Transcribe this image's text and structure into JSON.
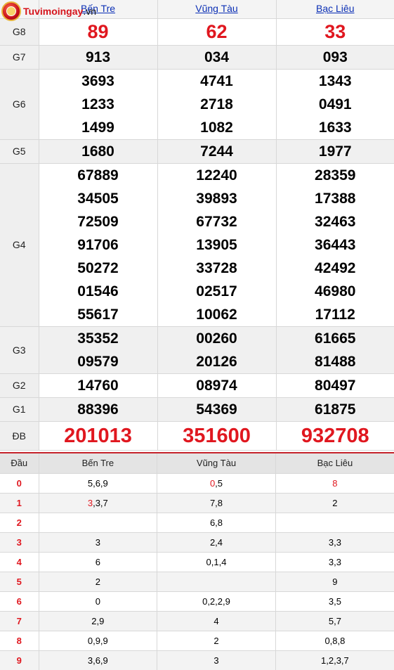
{
  "logo": {
    "name_main": "Tuvimoingay",
    "name_tld": ".vn"
  },
  "provinces": [
    "Bến Tre",
    "Vũng Tàu",
    "Bạc Liêu"
  ],
  "prizes": [
    {
      "label": "G8",
      "values": [
        [
          "89"
        ],
        [
          "62"
        ],
        [
          "33"
        ]
      ]
    },
    {
      "label": "G7",
      "values": [
        [
          "913"
        ],
        [
          "034"
        ],
        [
          "093"
        ]
      ]
    },
    {
      "label": "G6",
      "values": [
        [
          "3693",
          "1233",
          "1499"
        ],
        [
          "4741",
          "2718",
          "1082"
        ],
        [
          "1343",
          "0491",
          "1633"
        ]
      ]
    },
    {
      "label": "G5",
      "values": [
        [
          "1680"
        ],
        [
          "7244"
        ],
        [
          "1977"
        ]
      ]
    },
    {
      "label": "G4",
      "values": [
        [
          "67889",
          "34505",
          "72509",
          "91706",
          "50272",
          "01546",
          "55617"
        ],
        [
          "12240",
          "39893",
          "67732",
          "13905",
          "33728",
          "02517",
          "10062"
        ],
        [
          "28359",
          "17388",
          "32463",
          "36443",
          "42492",
          "46980",
          "17112"
        ]
      ]
    },
    {
      "label": "G3",
      "values": [
        [
          "35352",
          "09579"
        ],
        [
          "00260",
          "20126"
        ],
        [
          "61665",
          "81488"
        ]
      ]
    },
    {
      "label": "G2",
      "values": [
        [
          "14760"
        ],
        [
          "08974"
        ],
        [
          "80497"
        ]
      ]
    },
    {
      "label": "G1",
      "values": [
        [
          "88396"
        ],
        [
          "54369"
        ],
        [
          "61875"
        ]
      ]
    },
    {
      "label": "ĐB",
      "values": [
        [
          "201013"
        ],
        [
          "351600"
        ],
        [
          "932708"
        ]
      ]
    }
  ],
  "loto_header": {
    "dau": "Đầu",
    "cols": [
      "Bến Tre",
      "Vũng Tàu",
      "Bạc Liêu"
    ]
  },
  "loto": [
    {
      "dau": "0",
      "cells": [
        [
          [
            "5,6,9",
            false
          ]
        ],
        [
          [
            "0",
            true
          ],
          [
            ",5",
            false
          ]
        ],
        [
          [
            "8",
            true
          ]
        ]
      ]
    },
    {
      "dau": "1",
      "cells": [
        [
          [
            "3",
            true
          ],
          [
            ",3,7",
            false
          ]
        ],
        [
          [
            "7,8",
            false
          ]
        ],
        [
          [
            "2",
            false
          ]
        ]
      ]
    },
    {
      "dau": "2",
      "cells": [
        [],
        [
          [
            "6,8",
            false
          ]
        ],
        []
      ]
    },
    {
      "dau": "3",
      "cells": [
        [
          [
            "3",
            false
          ]
        ],
        [
          [
            "2,4",
            false
          ]
        ],
        [
          [
            "3,3",
            false
          ]
        ]
      ]
    },
    {
      "dau": "4",
      "cells": [
        [
          [
            "6",
            false
          ]
        ],
        [
          [
            "0,1,4",
            false
          ]
        ],
        [
          [
            "3,3",
            false
          ]
        ]
      ]
    },
    {
      "dau": "5",
      "cells": [
        [
          [
            "2",
            false
          ]
        ],
        [],
        [
          [
            "9",
            false
          ]
        ]
      ]
    },
    {
      "dau": "6",
      "cells": [
        [
          [
            "0",
            false
          ]
        ],
        [
          [
            "0,2,2,9",
            false
          ]
        ],
        [
          [
            "3,5",
            false
          ]
        ]
      ]
    },
    {
      "dau": "7",
      "cells": [
        [
          [
            "2,9",
            false
          ]
        ],
        [
          [
            "4",
            false
          ]
        ],
        [
          [
            "5,7",
            false
          ]
        ]
      ]
    },
    {
      "dau": "8",
      "cells": [
        [
          [
            "0,9,9",
            false
          ]
        ],
        [
          [
            "2",
            false
          ]
        ],
        [
          [
            "0,8,8",
            false
          ]
        ]
      ]
    },
    {
      "dau": "9",
      "cells": [
        [
          [
            "3,6,9",
            false
          ]
        ],
        [
          [
            "3",
            false
          ]
        ],
        [
          [
            "1,2,3,7",
            false
          ]
        ]
      ]
    }
  ],
  "colors": {
    "accent_red": "#e0171f",
    "link_blue": "#0b2fb5"
  }
}
